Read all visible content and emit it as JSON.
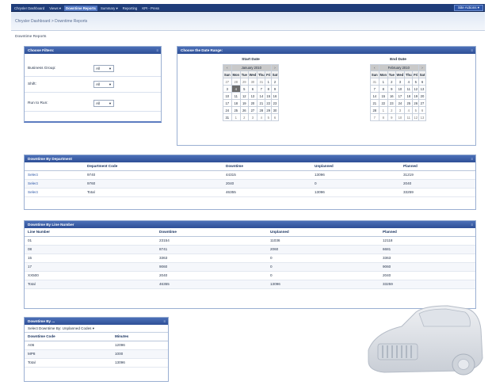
{
  "topbar": {
    "nav": [
      "Chrysler Dashboard",
      "Views ▾",
      "Downtime Reports",
      "Summary ▾",
      "Reporting",
      "KPI - Press"
    ],
    "active_index": 2,
    "site_actions": "Site Actions ▾"
  },
  "breadcrumb": "Chrysler Dashboard > Downtime Reports",
  "page_title": "Downtime Reports",
  "filters": {
    "title": "Choose Filters:",
    "rows": [
      {
        "label": "Business Group:",
        "value": "All"
      },
      {
        "label": "Shift:",
        "value": "All"
      },
      {
        "label": "Run to Run:",
        "value": "All"
      }
    ]
  },
  "date_range": {
    "title": "Choose the Date Range:",
    "start": {
      "caption": "Start Date",
      "month": "January 2010",
      "days_header": [
        "Sun",
        "Mon",
        "Tue",
        "Wed",
        "Thu",
        "Fri",
        "Sat"
      ],
      "weeks": [
        [
          "27",
          "28",
          "29",
          "30",
          "31",
          "1",
          "2"
        ],
        [
          "3",
          "4",
          "5",
          "6",
          "7",
          "8",
          "9"
        ],
        [
          "10",
          "11",
          "12",
          "13",
          "14",
          "15",
          "16"
        ],
        [
          "17",
          "18",
          "19",
          "20",
          "21",
          "22",
          "23"
        ],
        [
          "24",
          "25",
          "26",
          "27",
          "28",
          "29",
          "30"
        ],
        [
          "31",
          "1",
          "2",
          "3",
          "4",
          "5",
          "6"
        ]
      ]
    },
    "end": {
      "caption": "End Date",
      "month": "February 2010",
      "days_header": [
        "Sun",
        "Mon",
        "Tue",
        "Wed",
        "Thu",
        "Fri",
        "Sat"
      ],
      "weeks": [
        [
          "31",
          "1",
          "2",
          "3",
          "4",
          "5",
          "6"
        ],
        [
          "7",
          "8",
          "9",
          "10",
          "11",
          "12",
          "13"
        ],
        [
          "14",
          "15",
          "16",
          "17",
          "18",
          "19",
          "20"
        ],
        [
          "21",
          "22",
          "23",
          "24",
          "25",
          "26",
          "27"
        ],
        [
          "28",
          "1",
          "2",
          "3",
          "4",
          "5",
          "6"
        ],
        [
          "7",
          "8",
          "9",
          "10",
          "11",
          "12",
          "13"
        ]
      ]
    }
  },
  "dept": {
    "title": "Downtime By Department",
    "headers": [
      "",
      "Department Code",
      "Downtime",
      "Unplanned",
      "Planned"
    ],
    "rows": [
      [
        "Select",
        "9740",
        "44315",
        "13096",
        "31219"
      ],
      [
        "Select",
        "9760",
        "2040",
        "0",
        "2040"
      ],
      [
        "Select",
        "Total",
        "46355",
        "13096",
        "33259"
      ]
    ]
  },
  "line": {
    "title": "Downtime By Line Number",
    "headers": [
      "Line Number",
      "Downtime",
      "Unplanned",
      "Planned"
    ],
    "rows": [
      [
        "01",
        "23154",
        "11036",
        "12118"
      ],
      [
        "08",
        "8741",
        "2060",
        "6681"
      ],
      [
        "15",
        "3363",
        "0",
        "3363"
      ],
      [
        "17",
        "9060",
        "0",
        "9060"
      ],
      [
        "XX500",
        "2040",
        "0",
        "2040"
      ],
      [
        "Total",
        "46355",
        "13096",
        "33259"
      ]
    ]
  },
  "by": {
    "title": "Downtime By ...",
    "select_label": "Select Downtime By:",
    "select_value": "Unplanned Codes ▾",
    "headers": [
      "Downtime Code",
      "Minutes"
    ],
    "rows": [
      [
        "A06",
        "12096"
      ],
      [
        "MP8",
        "1000"
      ],
      [
        "Total",
        "13096"
      ]
    ]
  }
}
